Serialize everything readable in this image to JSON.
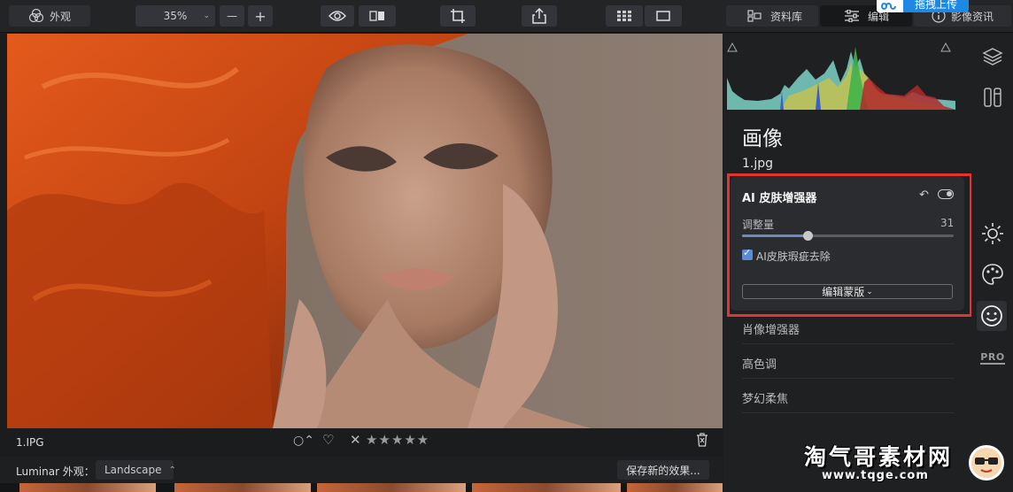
{
  "toolbar": {
    "looks_label": "外观",
    "zoom_value": "35%",
    "zoom_out": "—",
    "zoom_in": "+",
    "library_tab": "资料库",
    "edit_tab": "编辑",
    "info_tab": "影像资讯",
    "upload_label": "拖拽上传"
  },
  "image": {
    "filename": "1.IPG",
    "rating_stars": "★★★★★"
  },
  "bottom": {
    "luminar_looks": "Luminar 外观：",
    "preset_name": "Landscape",
    "save_button": "保存新的效果..."
  },
  "panel": {
    "section_title": "画像",
    "file_name": "1.jpg",
    "tool": {
      "title": "AI 皮肤增强器",
      "slider_label": "调整量",
      "slider_value": "31",
      "slider_fraction": 0.31,
      "checkbox_label": "AI皮肤瑕疵去除",
      "checkbox_checked": true,
      "mask_button": "编辑蒙版"
    },
    "other_tools": [
      "肖像增强器",
      "高色调",
      "梦幻柔焦"
    ]
  },
  "sidebar": {
    "pro_label": "PRO"
  },
  "watermark": {
    "text": "淘气哥素材网",
    "url": "www.tqge.com"
  },
  "colors": {
    "highlight_red": "#e8322f",
    "accent_blue": "#5a8dd6",
    "upload_blue": "#1e88e5"
  }
}
